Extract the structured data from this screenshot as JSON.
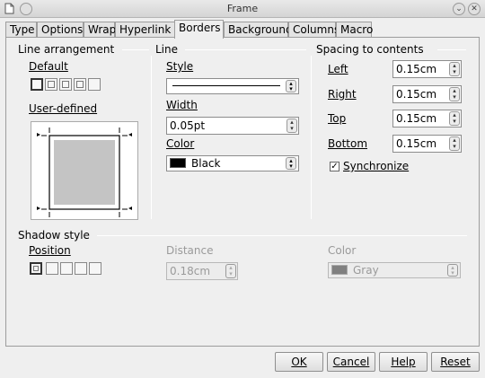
{
  "window": {
    "title": "Frame",
    "icons": {
      "app": "document-icon",
      "minimize": "chevron-down-icon",
      "close": "close-icon"
    }
  },
  "tabs": [
    "Type",
    "Options",
    "Wrap",
    "Hyperlink",
    "Borders",
    "Background",
    "Columns",
    "Macro"
  ],
  "active_tab": "Borders",
  "line_arrangement": {
    "title": "Line arrangement",
    "default_label": "Default",
    "user_defined_label": "User-defined"
  },
  "line": {
    "title": "Line",
    "style_label": "Style",
    "width_label": "Width",
    "width_value": "0.05pt",
    "color_label": "Color",
    "color_value": "Black",
    "color_hex": "#000000"
  },
  "spacing": {
    "title": "Spacing to contents",
    "left_label": "Left",
    "left_value": "0.15cm",
    "right_label": "Right",
    "right_value": "0.15cm",
    "top_label": "Top",
    "top_value": "0.15cm",
    "bottom_label": "Bottom",
    "bottom_value": "0.15cm",
    "synchronize_label": "Synchronize",
    "synchronize_checked": true
  },
  "shadow": {
    "title": "Shadow style",
    "position_label": "Position",
    "distance_label": "Distance",
    "distance_value": "0.18cm",
    "color_label": "Color",
    "color_value": "Gray",
    "color_hex": "#808080"
  },
  "buttons": {
    "ok": "OK",
    "cancel": "Cancel",
    "help": "Help",
    "reset": "Reset"
  }
}
